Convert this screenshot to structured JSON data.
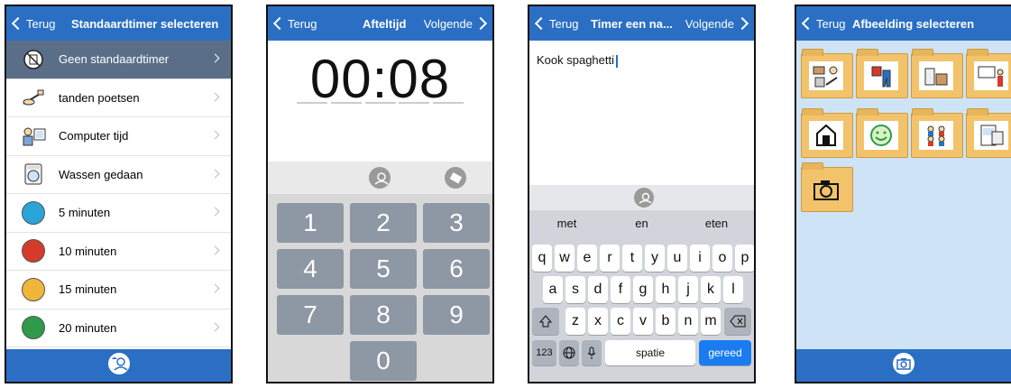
{
  "p1": {
    "back": "Terug",
    "title": "Standaardtimer selecteren",
    "items": [
      {
        "label": "Geen standaardtimer",
        "icon": "no-timer-icon",
        "selected": true
      },
      {
        "label": "tanden poetsen",
        "icon": "toothbrush-icon"
      },
      {
        "label": "Computer tijd",
        "icon": "computer-user-icon"
      },
      {
        "label": "Wassen gedaan",
        "icon": "washing-machine-icon"
      },
      {
        "label": "5 minuten",
        "icon": "blue-dot-icon",
        "color": "#2aa3d6"
      },
      {
        "label": "10 minuten",
        "icon": "red-dot-icon",
        "color": "#d63a2a"
      },
      {
        "label": "15 minuten",
        "icon": "yellow-dot-icon",
        "color": "#f0b63a"
      },
      {
        "label": "20 minuten",
        "icon": "green-dot-icon",
        "color": "#2e9a4a"
      }
    ]
  },
  "p2": {
    "back": "Terug",
    "title": "Afteltijd",
    "next": "Volgende",
    "time": "00:08",
    "keys": [
      "1",
      "2",
      "3",
      "4",
      "5",
      "6",
      "7",
      "8",
      "9",
      "0"
    ]
  },
  "p3": {
    "back": "Terug",
    "title": "Timer een na...",
    "next": "Volgende",
    "text": "Kook spaghetti",
    "suggestions": [
      "met",
      "en",
      "eten"
    ],
    "row1": [
      "q",
      "w",
      "e",
      "r",
      "t",
      "y",
      "u",
      "i",
      "o",
      "p"
    ],
    "row2": [
      "a",
      "s",
      "d",
      "f",
      "g",
      "h",
      "j",
      "k",
      "l"
    ],
    "row3": [
      "z",
      "x",
      "c",
      "v",
      "b",
      "n",
      "m"
    ],
    "num_label": "123",
    "space_label": "spatie",
    "done_label": "gereed"
  },
  "p4": {
    "back": "Terug",
    "title": "Afbeelding selecteren"
  },
  "colors": {
    "topbar": "#2a6fc4",
    "selected_row": "#5a6e88",
    "key": "#8e97a4",
    "link_blue": "#1a6fe0",
    "folder": "#f2c36b"
  }
}
